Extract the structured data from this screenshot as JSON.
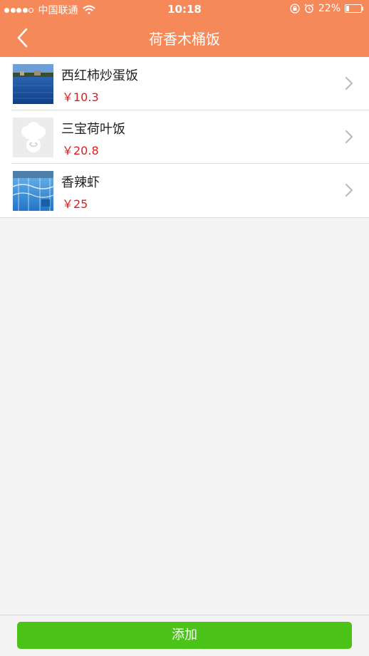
{
  "status_bar": {
    "carrier": "中国联通",
    "time": "10:18",
    "battery_text": "22%",
    "battery_level": 0.22
  },
  "nav": {
    "title": "荷香木桶饭",
    "back_icon": "chevron-left-icon"
  },
  "items": [
    {
      "name": "西红柿炒蛋饭",
      "price": "￥10.3",
      "thumb": "lake-photo"
    },
    {
      "name": "三宝荷叶饭",
      "price": "￥20.8",
      "thumb": "chef-placeholder"
    },
    {
      "name": "香辣虾",
      "price": "￥25",
      "thumb": "pool-photo"
    }
  ],
  "footer": {
    "add_label": "添加"
  },
  "colors": {
    "header": "#f5895a",
    "price": "#d81e1e",
    "add_button": "#4cc319",
    "background": "#f4f4f4"
  }
}
